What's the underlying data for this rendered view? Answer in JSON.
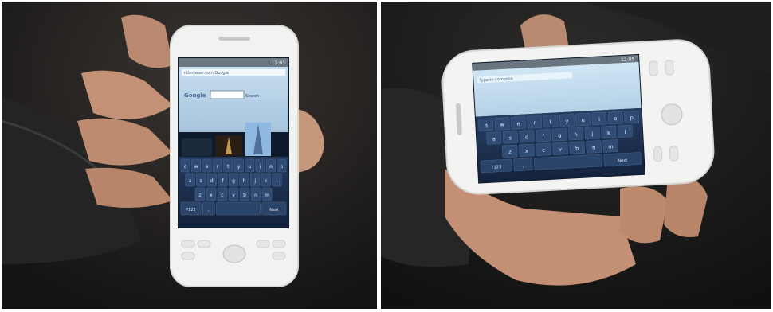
{
  "photos": [
    {
      "name": "portrait-phone-photo",
      "orientation": "portrait",
      "status_time": "12:03",
      "url_bar": "ntbrowser.com  Google",
      "search_button": "Search",
      "keyboard_rows": [
        "qwertyuiop",
        "asdfghjkl",
        "zxcvbnm"
      ],
      "bottom_keys": [
        "?123",
        ",",
        "",
        "Next"
      ],
      "colors": {
        "sleeve": "#2b2b2b",
        "background": "#161616",
        "phone_body": "#f2f2f0",
        "skin": "#c89a7c"
      }
    },
    {
      "name": "landscape-phone-photo",
      "orientation": "landscape",
      "status_time": "12:05",
      "text_field": "Type to compose",
      "keyboard_rows": [
        "qwertyuiop",
        "asdfghjkl",
        "zxcvbnm"
      ],
      "bottom_keys": [
        "?123",
        ",",
        "",
        "Next"
      ],
      "colors": {
        "sleeve": "#2a2a2a",
        "background": "#121212",
        "phone_body": "#f3f3f1",
        "skin": "#c59478"
      }
    }
  ]
}
